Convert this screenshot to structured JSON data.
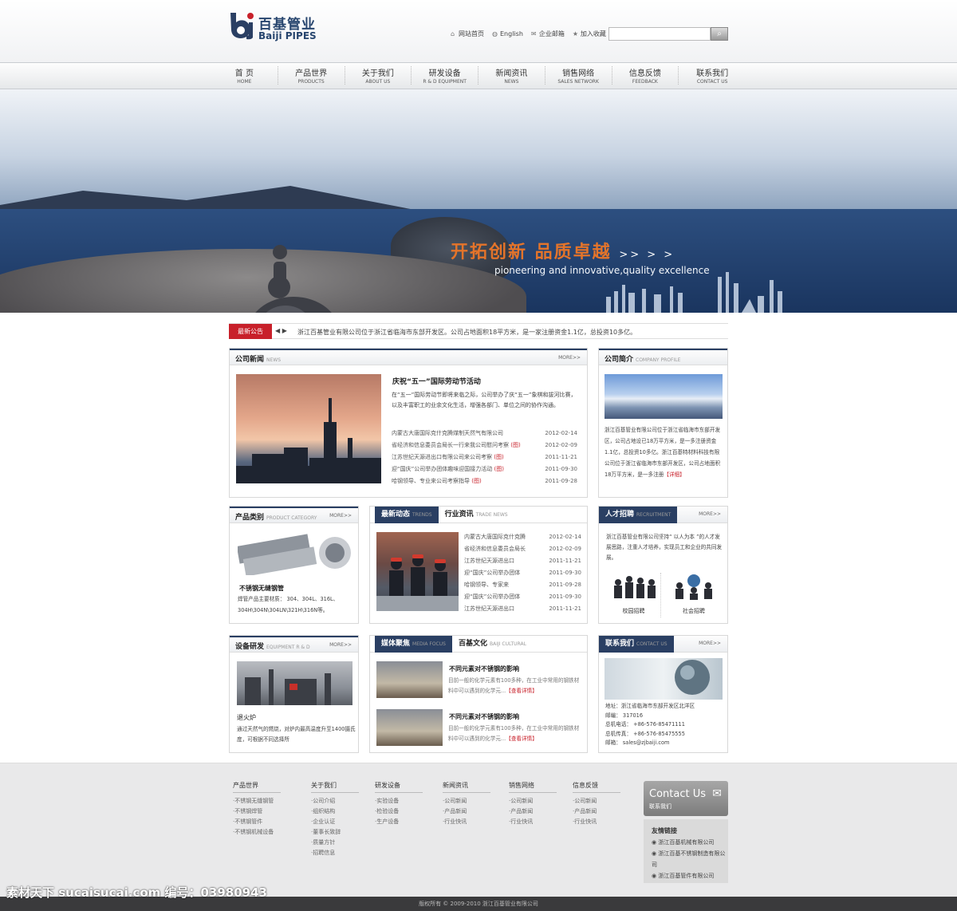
{
  "header": {
    "logo_cn": "百基管业",
    "logo_en": "Baiji PIPES",
    "toplinks": [
      "网站首页",
      "English",
      "企业邮箱",
      "加入收藏"
    ]
  },
  "nav": [
    {
      "cn": "首  页",
      "en": "HOME"
    },
    {
      "cn": "产品世界",
      "en": "PRODUCTS"
    },
    {
      "cn": "关于我们",
      "en": "ABOUT US"
    },
    {
      "cn": "研发设备",
      "en": "R & D EQUIPMENT"
    },
    {
      "cn": "新闻资讯",
      "en": "NEWS"
    },
    {
      "cn": "销售网络",
      "en": "SALES NETWORK"
    },
    {
      "cn": "信息反馈",
      "en": "FEEDBACK"
    },
    {
      "cn": "联系我们",
      "en": "CONTACT US"
    }
  ],
  "banner": {
    "slogan": "开拓创新  品质卓越",
    "arrows": ">> > >",
    "slogan_en": "pioneering and innovative,quality excellence"
  },
  "notice": {
    "tag": "最新公告",
    "text": "浙江百基管业有限公司位于浙江省临海市东部开发区。公司占地面积18平方米，是一家注册资金1.1亿，总投资10多亿。"
  },
  "news": {
    "title": "公司新闻",
    "title_en": "NEWS",
    "more": "MORE>>",
    "headline": "庆祝“五一”国际劳动节活动",
    "summary": "在“五一”国际劳动节即将来临之际，公司举办了庆“五一”象棋和拔河比赛，以及丰富职工的业余文化生活，增强各部门、单位之间的协作沟通。",
    "items": [
      {
        "t": "内蒙古大唐国际克什克腾煤制天然气有限公司",
        "badge": "",
        "d": "2012-02-14"
      },
      {
        "t": "省经济和信息委员会局长一行来我公司慰问考察",
        "badge": "(图)",
        "d": "2012-02-09"
      },
      {
        "t": "江苏世纪天源进出口有限公司来公司考察",
        "badge": "(图)",
        "d": "2011-11-21"
      },
      {
        "t": "迎“国庆”公司举办团体趣味迎国接力活动",
        "badge": "(图)",
        "d": "2011-09-30"
      },
      {
        "t": "哈钢领导、专业来公司考察指导",
        "badge": "(图)",
        "d": "2011-09-28"
      }
    ]
  },
  "profile": {
    "title": "公司简介",
    "title_en": "COMPANY PROFILE",
    "text": "浙江百基管业有限公司位于浙江省临海市东部开发区，公司占地设已18万平方米，是一多注册资金1.1亿，总投资10多亿。浙江百基特材料科技有限公司位于浙江省临海市东部开发区，公司占地面积18万平方米，是一多注册",
    "link": "【详细】"
  },
  "products": {
    "title": "产品类别",
    "title_en": "PRODUCT CATEGORY",
    "more": "MORE>>",
    "name": "不锈钢无缝钢管",
    "desc": "焊管产品主要材质：  304、304L、316L、304H\\304N\\304LN\\321H\\316N等。"
  },
  "trends": {
    "tab1": "最新动态",
    "tab1_en": "TRENDS",
    "tab2": "行业资讯",
    "tab2_en": "TRADE NEWS",
    "items": [
      {
        "t": "内蒙古大唐国际克什克腾",
        "d": "2012-02-14"
      },
      {
        "t": "省经济和信息委员会局长",
        "d": "2012-02-09"
      },
      {
        "t": "江苏世纪天源进出口",
        "d": "2011-11-21"
      },
      {
        "t": "迎“国庆”公司举办团体",
        "d": "2011-09-30"
      },
      {
        "t": "哈钢领导、专家来",
        "d": "2011-09-28"
      },
      {
        "t": "迎“国庆”公司举办团体",
        "d": "2011-09-30"
      },
      {
        "t": "江苏世纪天源进出口",
        "d": "2011-11-21"
      }
    ]
  },
  "recruit": {
    "title": "人才招聘",
    "title_en": "RECRUITMENT",
    "more": "MORE>>",
    "text": "浙江百基管业有限公司坚持“ 以人为本 ”的人才发展思路，注重人才培养，实现员工和企业的共同发展。",
    "campus": "校园招聘",
    "social": "社会招聘"
  },
  "equipment": {
    "title": "设备研发",
    "title_en": "EQUIPMENT R & D",
    "more": "MORE>>",
    "name": "退火炉",
    "desc": "通过天然气的燃烧，对炉内最高温度升至1400摄氏度，可根据不同选择所"
  },
  "media": {
    "tab1": "媒体聚焦",
    "tab1_en": "MEDIA FOCUS",
    "tab2": "百基文化",
    "tab2_en": "BAIJI CULTURAL",
    "items": [
      {
        "t": "不同元素对不锈钢的影响",
        "s": "目前一般的化学元素有100多种，在工业中常用的钢铁材料中可以遇到的化学元...",
        "link": "【查看详情】"
      },
      {
        "t": "不同元素对不锈钢的影响",
        "s": "目前一般的化学元素有100多种，在工业中常用的钢铁材料中可以遇到的化学元...",
        "link": "【查看详情】"
      }
    ]
  },
  "contact": {
    "title": "联系我们",
    "title_en": "CONTACT US",
    "more": "MORE>>",
    "address": "地址：浙江省临海市东部开发区北洋区",
    "zip": "邮编：  317016",
    "tel": "总机电话： +86-576-85471111",
    "fax": "总机传真： +86-576-85475555",
    "email": "邮箱： sales@zjbaiji.com"
  },
  "footer": {
    "cols": [
      {
        "h": "产品世界",
        "items": [
          "·不锈钢无缝钢管",
          "·不锈钢焊管",
          "·不锈钢管件",
          "·不锈钢机械设备"
        ]
      },
      {
        "h": "关于我们",
        "items": [
          "·公司介绍",
          "·组织结构",
          "·企业认证",
          "·董事长致辞",
          "·质量方针",
          "·招聘信息"
        ]
      },
      {
        "h": "研发设备",
        "items": [
          "·实验设备",
          "·检验设备",
          "·生产设备"
        ]
      },
      {
        "h": "新闻资讯",
        "items": [
          "·公司新闻",
          "·产品新闻",
          "·行业快讯"
        ]
      },
      {
        "h": "销售网络",
        "items": [
          "·公司新闻",
          "·产品新闻",
          "·行业快讯"
        ]
      },
      {
        "h": "信息反馈",
        "items": [
          "·公司新闻",
          "·产品新闻",
          "·行业快讯"
        ]
      }
    ],
    "contact_en": "Contact Us",
    "contact_cn": "联系我们",
    "links_title": "友情链接",
    "links": [
      "浙江百基机械有限公司",
      "浙江百基不锈钢制造有限公司",
      "浙江百基管件有限公司"
    ],
    "copyright": "版权所有 © 2009-2010    浙江百基管业有限公司"
  },
  "watermark": "素材天下 sucaisucai.com  编号：03980943"
}
